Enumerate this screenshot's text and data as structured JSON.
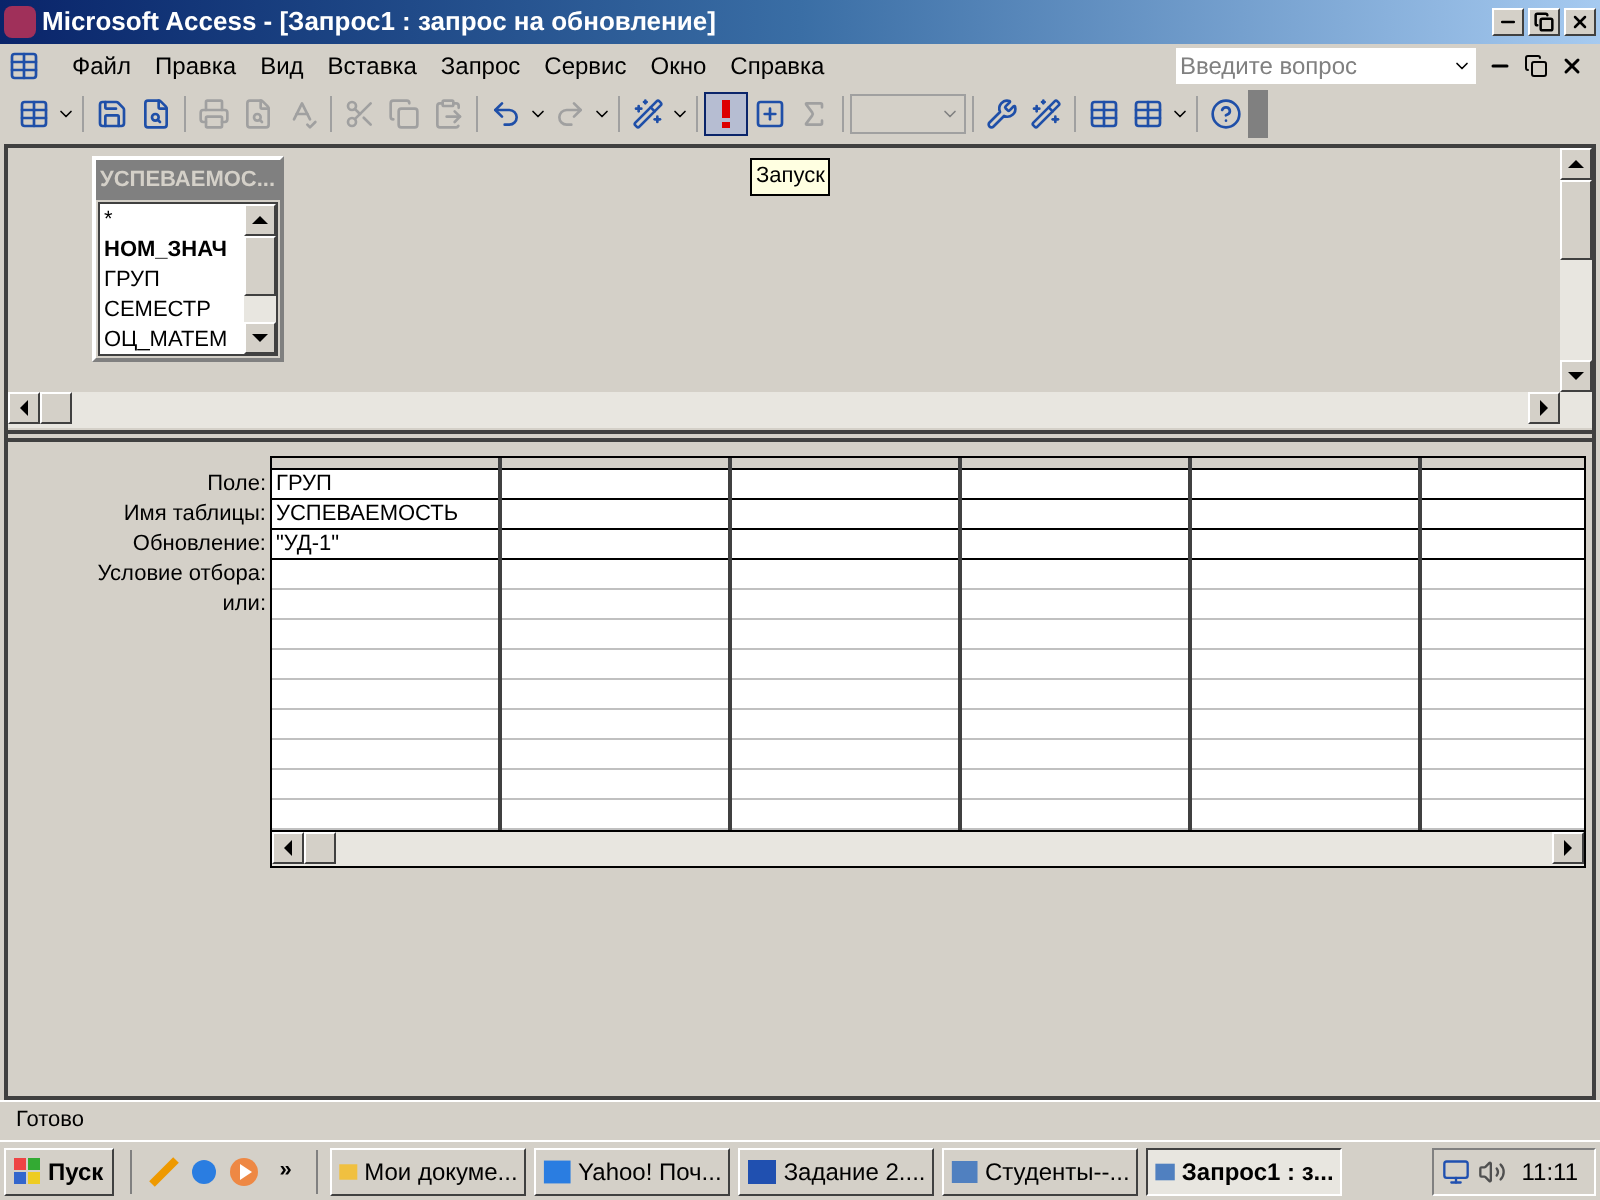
{
  "window": {
    "title": "Microsoft Access - [Запрос1 : запрос на обновление]"
  },
  "menu": [
    "Файл",
    "Правка",
    "Вид",
    "Вставка",
    "Запрос",
    "Сервис",
    "Окно",
    "Справка"
  ],
  "help_search": {
    "placeholder": "Введите вопрос"
  },
  "toolbar": {
    "run_pressed": true,
    "tooltip": "Запуск"
  },
  "field_list": {
    "title": "УСПЕВАЕМОС...",
    "fields": [
      {
        "name": "*",
        "primary_key": false
      },
      {
        "name": "НОМ_ЗНАЧ",
        "primary_key": true
      },
      {
        "name": "ГРУП",
        "primary_key": false
      },
      {
        "name": "СЕМЕСТР",
        "primary_key": false
      },
      {
        "name": "ОЦ_МАТЕМ",
        "primary_key": false
      }
    ]
  },
  "grid": {
    "row_labels": [
      "Поле:",
      "Имя таблицы:",
      "Обновление:",
      "Условие отбора:",
      "или:"
    ],
    "columns": [
      {
        "field": "ГРУП",
        "table": "УСПЕВАЕМОСТЬ",
        "update": "\"УД-1\""
      }
    ]
  },
  "status_bar": {
    "text": "Готово"
  },
  "taskbar": {
    "start": "Пуск",
    "more": "»",
    "clock": "11:11",
    "buttons": [
      {
        "label": "Мои докуме...",
        "kind": "folder",
        "selected": false
      },
      {
        "label": "Yahoo! Поч...",
        "kind": "browser",
        "selected": false
      },
      {
        "label": "Задание 2....",
        "kind": "word",
        "selected": false
      },
      {
        "label": "Студенты--...",
        "kind": "access",
        "selected": false
      },
      {
        "label": "Запрос1 : з...",
        "kind": "access",
        "selected": true
      }
    ]
  }
}
